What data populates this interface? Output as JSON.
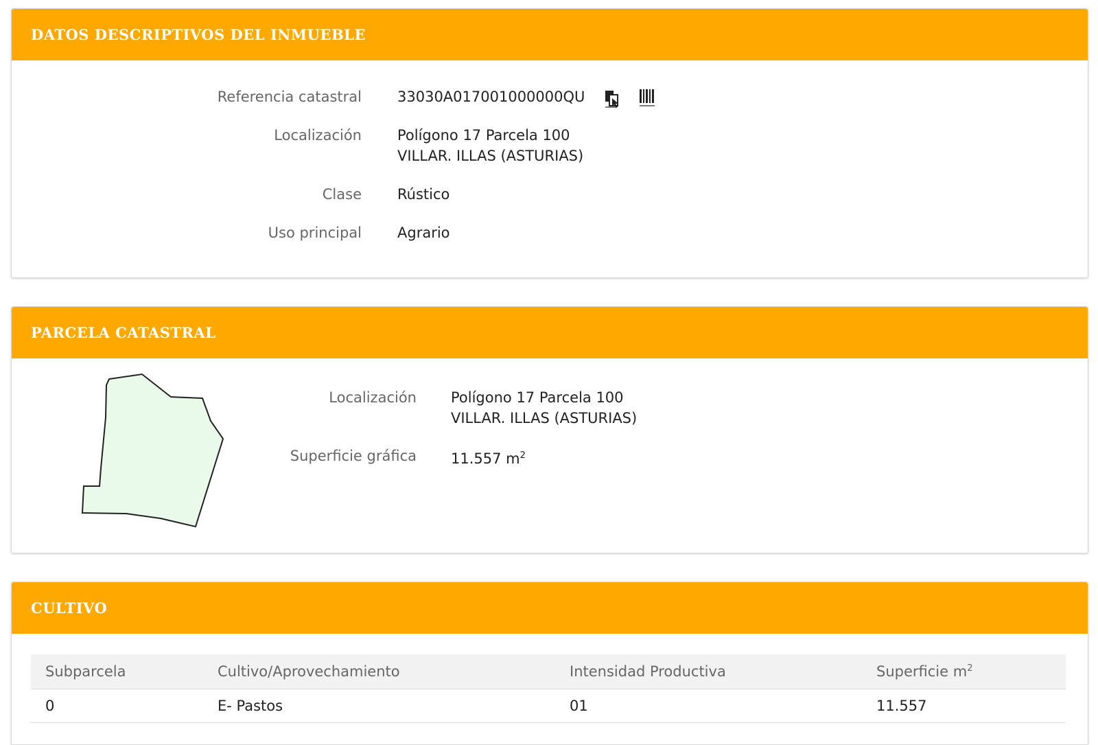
{
  "panel1": {
    "title": "DATOS DESCRIPTIVOS DEL INMUEBLE",
    "ref_label": "Referencia catastral",
    "ref_value": "33030A017001000000QU",
    "loc_label": "Localización",
    "loc_line1": "Polígono 17 Parcela 100",
    "loc_line2": "VILLAR. ILLAS (ASTURIAS)",
    "clase_label": "Clase",
    "clase_value": "Rústico",
    "uso_label": "Uso principal",
    "uso_value": "Agrario"
  },
  "panel2": {
    "title": "PARCELA CATASTRAL",
    "loc_label": "Localización",
    "loc_line1": "Polígono 17 Parcela 100",
    "loc_line2": "VILLAR. ILLAS (ASTURIAS)",
    "sup_label": "Superficie gráfica",
    "sup_value": "11.557 m",
    "sup_unit_exp": "2"
  },
  "panel3": {
    "title": "CULTIVO",
    "headers": {
      "subparcela": "Subparcela",
      "cultivo": "Cultivo/Aprovechamiento",
      "intensidad": "Intensidad Productiva",
      "superficie": "Superficie m",
      "superficie_exp": "2"
    },
    "row": {
      "subparcela": "0",
      "cultivo": "E- Pastos",
      "intensidad": "01",
      "superficie": "11.557"
    }
  },
  "colors": {
    "header": "#ffa800",
    "parcel_fill": "#eafaea",
    "parcel_stroke": "#222222"
  },
  "icons": {
    "copy": "copy-icon",
    "barcode": "barcode-icon"
  }
}
